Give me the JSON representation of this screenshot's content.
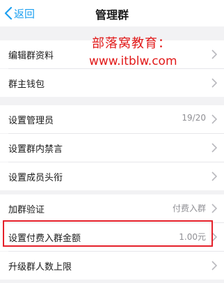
{
  "header": {
    "back_label": "返回",
    "title": "管理群"
  },
  "overlay": {
    "line1": "部落窝教育：",
    "line2": "www.itblw.com"
  },
  "items": [
    {
      "label": "编辑群资料",
      "value": ""
    },
    {
      "label": "群主钱包",
      "value": ""
    },
    {
      "label": "设置管理员",
      "value": "19/20"
    },
    {
      "label": "设置群内禁言",
      "value": ""
    },
    {
      "label": "设置成员头衔",
      "value": ""
    },
    {
      "label": "加群验证",
      "value": "付费入群"
    },
    {
      "label": "设置付费入群金额",
      "value": "1.00元"
    },
    {
      "label": "升级群人数上限",
      "value": ""
    }
  ],
  "colors": {
    "accent": "#1ea0f0",
    "highlight": "#e5202a",
    "overlay_text": "#e11919"
  }
}
